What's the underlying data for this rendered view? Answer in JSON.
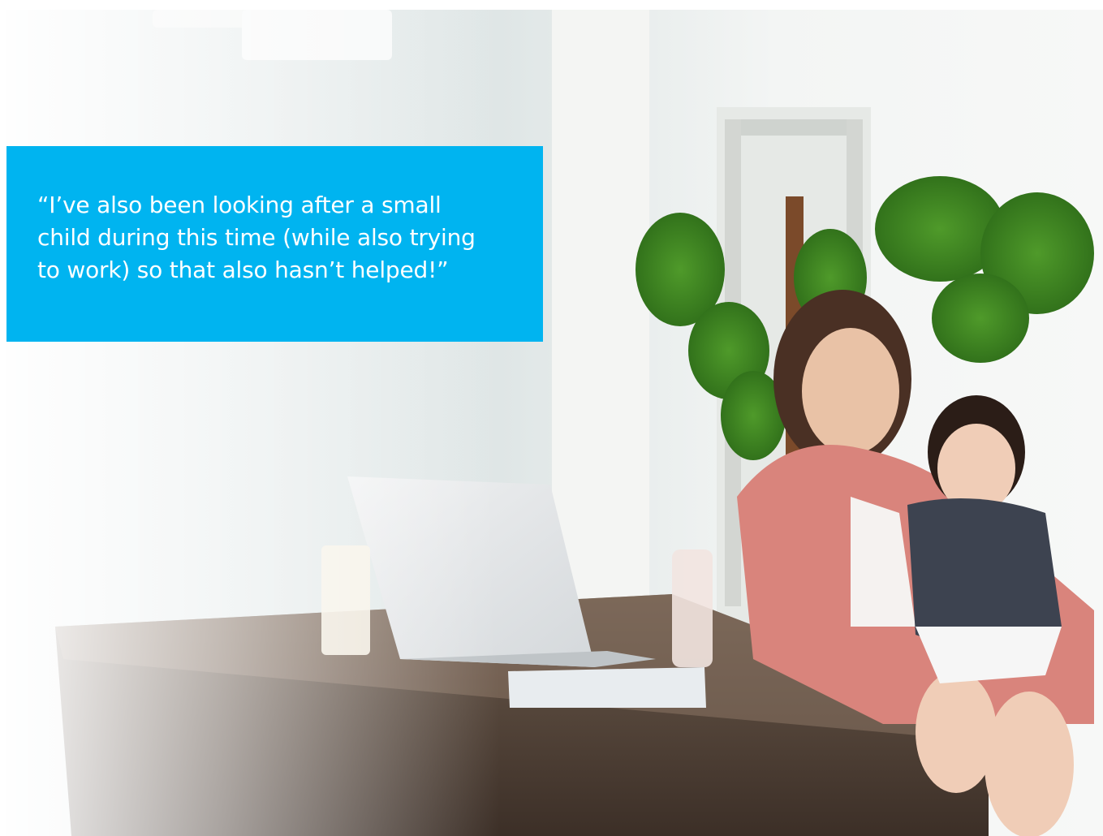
{
  "colors": {
    "accent": "#00b4f0",
    "quote_text": "#ffffff"
  },
  "photo": {
    "subject": "woman-holding-baby-at-desk-with-laptop"
  },
  "quote": {
    "lines": [
      "“I’ve also been looking after a small",
      "child during this time (while also trying",
      "to work) so that also hasn’t helped!”"
    ]
  }
}
